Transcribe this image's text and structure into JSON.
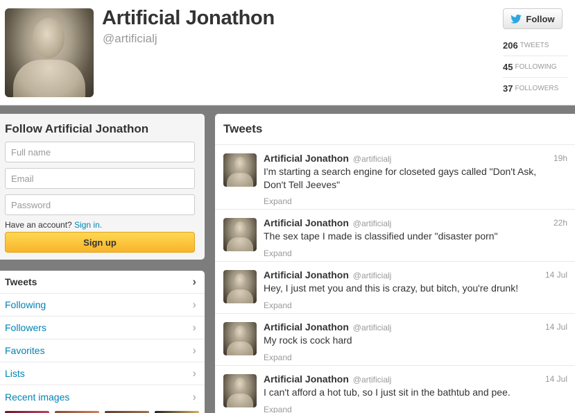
{
  "profile": {
    "name": "Artificial Jonathon",
    "handle": "@artificialj",
    "follow_label": "Follow",
    "stats": [
      {
        "num": "206",
        "label": "TWEETS"
      },
      {
        "num": "45",
        "label": "FOLLOWING"
      },
      {
        "num": "37",
        "label": "FOLLOWERS"
      }
    ]
  },
  "signup": {
    "title": "Follow Artificial Jonathon",
    "fullname_placeholder": "Full name",
    "email_placeholder": "Email",
    "password_placeholder": "Password",
    "have_account": "Have an account?",
    "signin_link": "Sign in.",
    "button": "Sign up"
  },
  "nav": {
    "items": [
      {
        "label": "Tweets"
      },
      {
        "label": "Following"
      },
      {
        "label": "Followers"
      },
      {
        "label": "Favorites"
      },
      {
        "label": "Lists"
      },
      {
        "label": "Recent images"
      }
    ],
    "chevron": "›"
  },
  "timeline": {
    "title": "Tweets",
    "expand_label": "Expand",
    "tweets": [
      {
        "name": "Artificial Jonathon",
        "handle": "@artificialj",
        "time": "19h",
        "text": "I'm starting a search engine for closeted gays called \"Don't Ask, Don't Tell Jeeves\""
      },
      {
        "name": "Artificial Jonathon",
        "handle": "@artificialj",
        "time": "22h",
        "text": "The sex tape I made is classified under \"disaster porn\""
      },
      {
        "name": "Artificial Jonathon",
        "handle": "@artificialj",
        "time": "14 Jul",
        "text": "Hey, I just met you and this is crazy, but bitch, you're drunk!"
      },
      {
        "name": "Artificial Jonathon",
        "handle": "@artificialj",
        "time": "14 Jul",
        "text": "My rock is cock hard"
      },
      {
        "name": "Artificial Jonathon",
        "handle": "@artificialj",
        "time": "14 Jul",
        "text": "I can't afford a hot tub, so I just sit in the bathtub and pee."
      }
    ]
  },
  "colors": {
    "link": "#0084b4",
    "signup_button": "#f8b52a",
    "page_bg": "#7d7d7d"
  }
}
